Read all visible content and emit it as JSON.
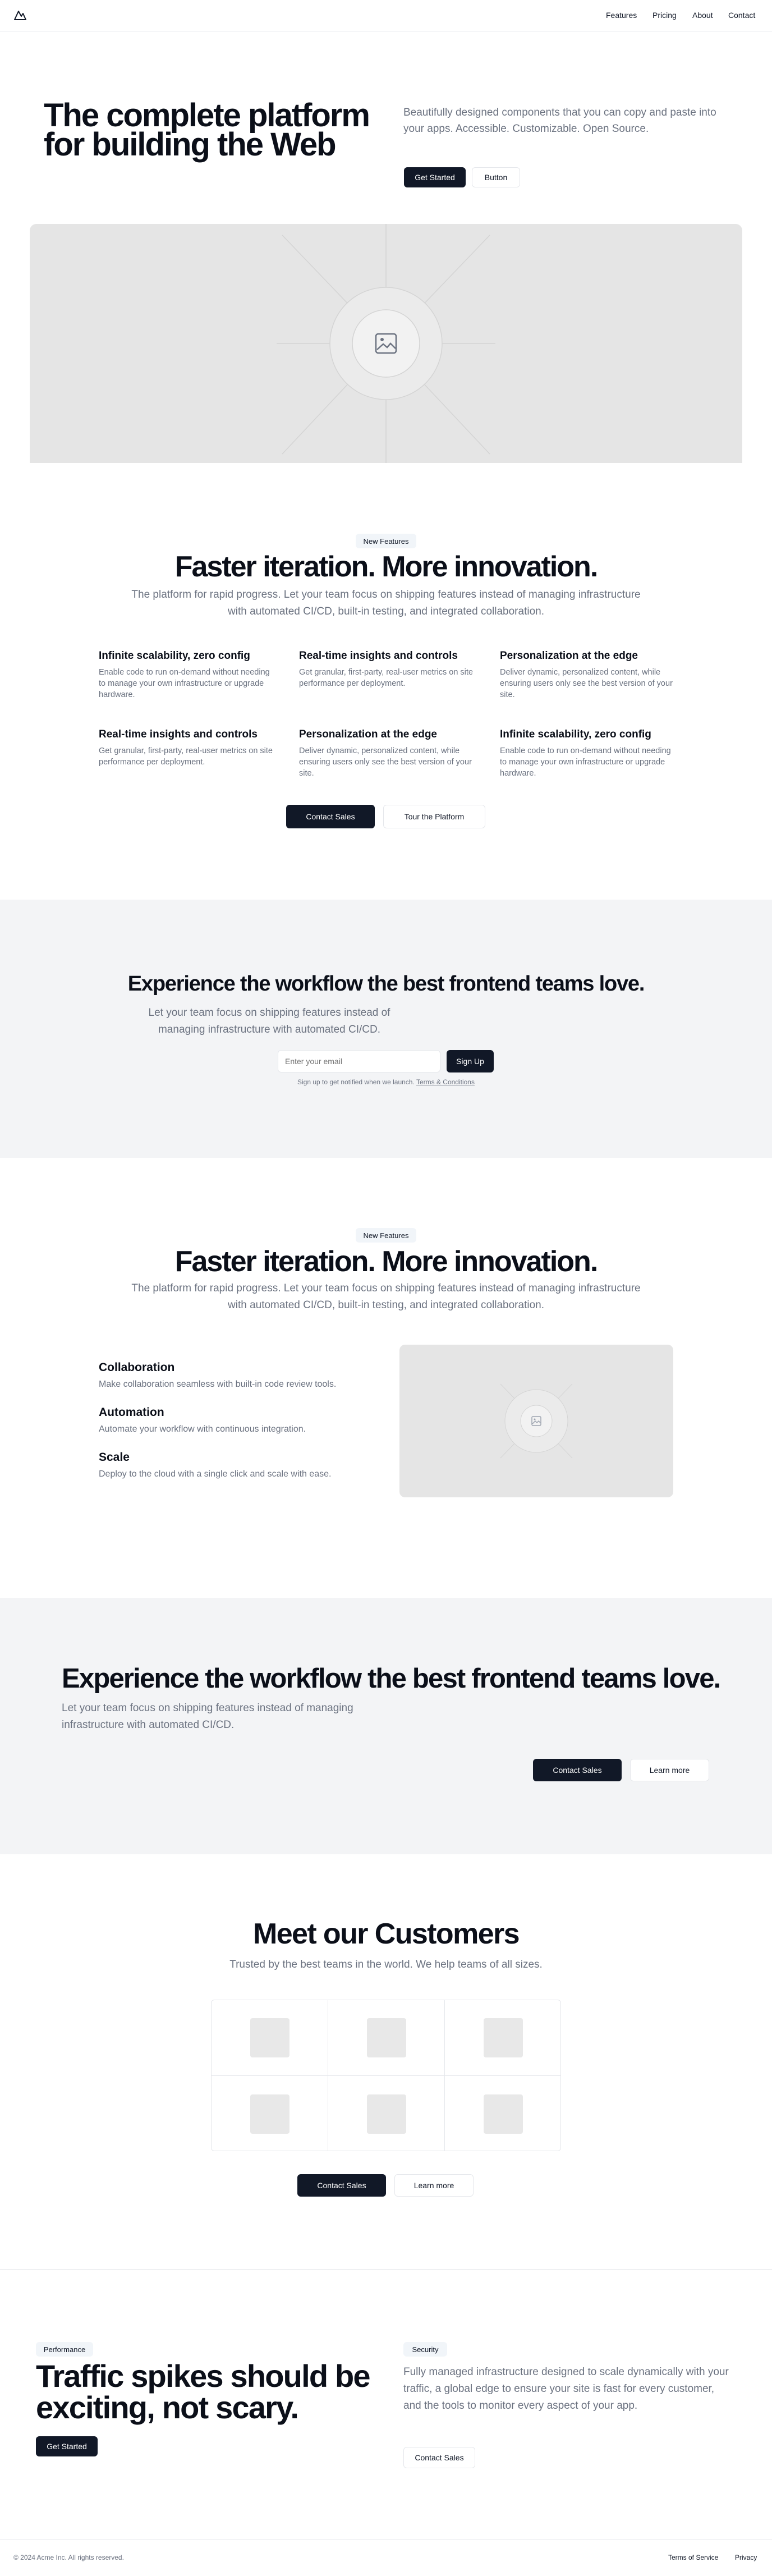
{
  "nav": {
    "logo_icon": "mountain-logo-icon",
    "links": [
      "Features",
      "Pricing",
      "About",
      "Contact"
    ]
  },
  "hero": {
    "title_line1": "The complete platform",
    "title_line2": "for building the Web",
    "description": "Beautifully designed components that you can copy and paste into your apps. Accessible. Customizable. Open Source.",
    "primary_label": "Get Started",
    "secondary_label": "Button",
    "image_icon": "image-placeholder-icon"
  },
  "features1": {
    "badge": "New Features",
    "title": "Faster iteration. More innovation.",
    "subtitle": "The platform for rapid progress. Let your team focus on shipping features instead of managing infrastructure with automated CI/CD, built-in testing, and integrated collaboration.",
    "items": [
      {
        "title": "Infinite scalability, zero config",
        "desc": "Enable code to run on-demand without needing to manage your own infrastructure or upgrade hardware."
      },
      {
        "title": "Real-time insights and controls",
        "desc": "Get granular, first-party, real-user metrics on site performance per deployment."
      },
      {
        "title": "Personalization at the edge",
        "desc": "Deliver dynamic, personalized content, while ensuring users only see the best version of your site."
      },
      {
        "title": "Real-time insights and controls",
        "desc": "Get granular, first-party, real-user metrics on site performance per deployment."
      },
      {
        "title": "Personalization at the edge",
        "desc": "Deliver dynamic, personalized content, while ensuring users only see the best version of your site."
      },
      {
        "title": "Infinite scalability, zero config",
        "desc": "Enable code to run on-demand without needing to manage your own infrastructure or upgrade hardware."
      }
    ],
    "primary_label": "Contact Sales",
    "secondary_label": "Tour the Platform"
  },
  "signup": {
    "title": "Experience the workflow the best frontend teams love.",
    "subtitle": "Let your team focus on shipping features instead of managing infrastructure with automated CI/CD.",
    "email_placeholder": "Enter your email",
    "button_label": "Sign Up",
    "note": "Sign up to get notified when we launch.",
    "terms_link": "Terms & Conditions"
  },
  "features2": {
    "badge": "New Features",
    "title": "Faster iteration. More innovation.",
    "subtitle": "The platform for rapid progress. Let your team focus on shipping features instead of managing infrastructure with automated CI/CD, built-in testing, and integrated collaboration.",
    "items": [
      {
        "title": "Collaboration",
        "desc": "Make collaboration seamless with built-in code review tools."
      },
      {
        "title": "Automation",
        "desc": "Automate your workflow with continuous integration."
      },
      {
        "title": "Scale",
        "desc": "Deploy to the cloud with a single click and scale with ease."
      }
    ]
  },
  "cta": {
    "title": "Experience the workflow the best frontend teams love.",
    "subtitle": "Let your team focus on shipping features instead of managing infrastructure with automated CI/CD.",
    "primary_label": "Contact Sales",
    "secondary_label": "Learn more"
  },
  "customers": {
    "title": "Meet our Customers",
    "subtitle": "Trusted by the best teams in the world. We help teams of all sizes.",
    "primary_label": "Contact Sales",
    "secondary_label": "Learn more"
  },
  "traffic": {
    "badge": "Performance",
    "title_line1": "Traffic spikes should be",
    "title_line2": "exciting, not scary.",
    "primary_label": "Get Started",
    "security_badge": "Security",
    "description": "Fully managed infrastructure designed to scale dynamically with your traffic, a global edge to ensure your site is fast for every customer, and the tools to monitor every aspect of your app.",
    "secondary_label": "Contact Sales"
  },
  "footer": {
    "copyright": "© 2024 Acme Inc. All rights reserved.",
    "links": [
      "Terms of Service",
      "Privacy"
    ]
  },
  "colors": {
    "dark": "#111827",
    "muted": "#6b7280",
    "section_gray": "#f3f4f6",
    "placeholder": "#e5e5e5"
  }
}
